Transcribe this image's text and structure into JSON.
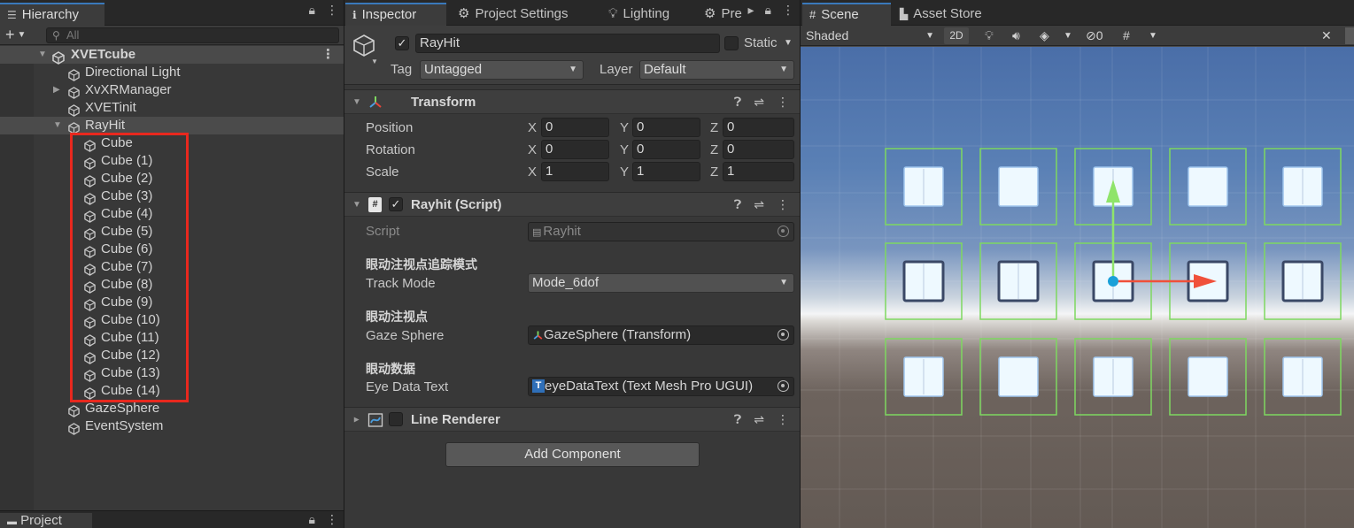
{
  "hierarchy": {
    "tab_label": "Hierarchy",
    "search_placeholder": "All",
    "scene_name": "XVETcube",
    "items": [
      {
        "label": "Directional Light"
      },
      {
        "label": "XvXRManager"
      },
      {
        "label": "XVETinit"
      },
      {
        "label": "RayHit"
      },
      {
        "label": "Cube"
      },
      {
        "label": "Cube (1)"
      },
      {
        "label": "Cube (2)"
      },
      {
        "label": "Cube (3)"
      },
      {
        "label": "Cube (4)"
      },
      {
        "label": "Cube (5)"
      },
      {
        "label": "Cube (6)"
      },
      {
        "label": "Cube (7)"
      },
      {
        "label": "Cube (8)"
      },
      {
        "label": "Cube (9)"
      },
      {
        "label": "Cube (10)"
      },
      {
        "label": "Cube (11)"
      },
      {
        "label": "Cube (12)"
      },
      {
        "label": "Cube (13)"
      },
      {
        "label": "Cube (14)"
      },
      {
        "label": "GazeSphere"
      },
      {
        "label": "EventSystem"
      }
    ],
    "project_tab": "Project"
  },
  "inspector": {
    "tabs": [
      {
        "label": "Inspector"
      },
      {
        "label": "Project Settings"
      },
      {
        "label": "Lighting"
      },
      {
        "label": "Pre"
      }
    ],
    "object_name": "RayHit",
    "static_label": "Static",
    "tag_label": "Tag",
    "tag_value": "Untagged",
    "layer_label": "Layer",
    "layer_value": "Default",
    "transform": {
      "title": "Transform",
      "position_label": "Position",
      "rotation_label": "Rotation",
      "scale_label": "Scale",
      "position": {
        "x": "0",
        "y": "0",
        "z": "0"
      },
      "rotation": {
        "x": "0",
        "y": "0",
        "z": "0"
      },
      "scale": {
        "x": "1",
        "y": "1",
        "z": "1"
      },
      "axis_x": "X",
      "axis_y": "Y",
      "axis_z": "Z"
    },
    "script_component": {
      "title": "Rayhit (Script)",
      "script_label": "Script",
      "script_value": "Rayhit",
      "header_mode": "眼动注视点追踪模式",
      "track_mode_label": "Track Mode",
      "track_mode_value": "Mode_6dof",
      "header_gaze": "眼动注视点",
      "gaze_sphere_label": "Gaze Sphere",
      "gaze_sphere_value": "GazeSphere (Transform)",
      "header_data": "眼动数据",
      "eye_data_label": "Eye Data Text",
      "eye_data_value": "eyeDataText (Text Mesh Pro UGUI)"
    },
    "line_renderer": {
      "title": "Line Renderer"
    },
    "add_component": "Add Component"
  },
  "scene": {
    "tabs": [
      {
        "label": "Scene"
      },
      {
        "label": "Asset Store"
      }
    ],
    "shading_mode": "Shaded",
    "toggle_2d": "2D",
    "hidden_count": "0",
    "gizmo_colors": {
      "y_axis": "#8fe46a",
      "x_axis": "#f0503a",
      "bounds": "#7ed860",
      "center": "#1aa0d8"
    }
  }
}
